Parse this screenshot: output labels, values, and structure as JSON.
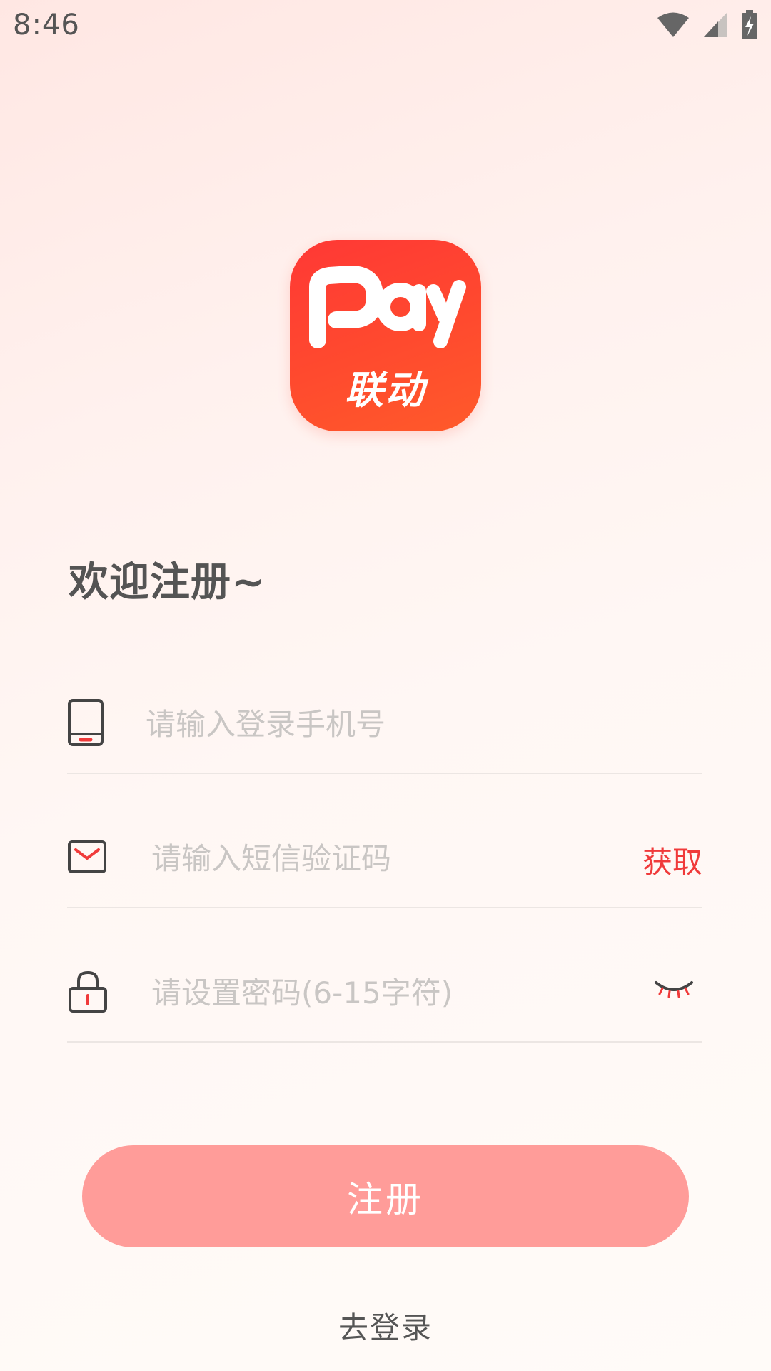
{
  "status_bar": {
    "time": "8:46"
  },
  "logo": {
    "wordmark": "Pay",
    "brand_cn": "联动",
    "colors": {
      "top": "#FF3835",
      "bottom": "#FF5A2A"
    }
  },
  "welcome": {
    "title": "欢迎注册~"
  },
  "form": {
    "phone": {
      "placeholder": "请输入登录手机号",
      "value": "",
      "icon": "phone-icon"
    },
    "sms": {
      "placeholder": "请输入短信验证码",
      "value": "",
      "icon": "message-icon",
      "get_code_label": "获取"
    },
    "password": {
      "placeholder": "请设置密码(6-15字符)",
      "value": "",
      "icon": "lock-icon",
      "toggle_icon": "eye-closed-icon"
    }
  },
  "actions": {
    "register_label": "注册",
    "go_login_label": "去登录"
  },
  "colors": {
    "accent": "#F03A3A",
    "button": "#FF9C99",
    "placeholder": "#C9C6C4"
  }
}
